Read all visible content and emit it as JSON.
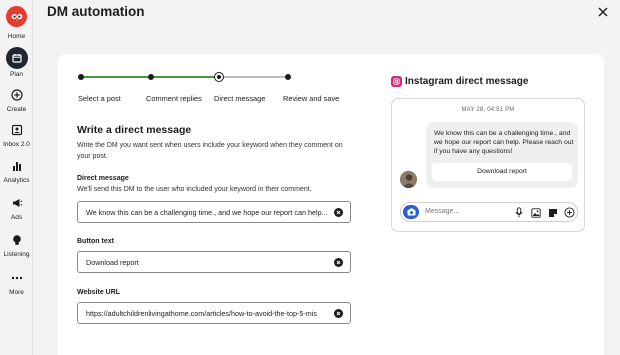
{
  "header": {
    "title": "DM automation"
  },
  "sidebar": {
    "items": [
      {
        "label": "Home",
        "icon": "home-icon"
      },
      {
        "label": "Plan",
        "icon": "calendar-icon"
      },
      {
        "label": "Create",
        "icon": "plus-icon"
      },
      {
        "label": "Inbox 2.0",
        "icon": "inbox-icon"
      },
      {
        "label": "Analytics",
        "icon": "chart-icon"
      },
      {
        "label": "Ads",
        "icon": "megaphone-icon"
      },
      {
        "label": "Listening",
        "icon": "lightbulb-icon"
      },
      {
        "label": "More",
        "icon": "ellipsis-icon"
      }
    ]
  },
  "steps": [
    {
      "label": "Select a post",
      "state": "done"
    },
    {
      "label": "Comment replies",
      "state": "done"
    },
    {
      "label": "Direct message",
      "state": "current"
    },
    {
      "label": "Review and save",
      "state": "upcoming"
    }
  ],
  "form": {
    "heading": "Write a direct message",
    "description": "Write the DM you want sent when users include your keyword when they comment on your post.",
    "dm_label": "Direct message",
    "dm_hint": "We'll send this DM to the user who included your keyword in their comment.",
    "dm_value": "We know this can be a challenging time., and we hope our report can help...",
    "button_label": "Button text",
    "button_value": "Download report",
    "url_label": "Website URL",
    "url_value": "https://adultchildrenlivingathome.com/articles/how-to-avoid-the-top-5-mis"
  },
  "preview": {
    "title": "Instagram direct message",
    "timestamp": "MAY 28, 04:51 PM",
    "message": "We know this can be a challenging time., and we hope our report can help. Please reach out if you have any questions!",
    "button": "Download report",
    "composer_placeholder": "Message..."
  },
  "colors": {
    "accent_green": "#3f9a3a",
    "brand_red": "#e53b30",
    "instagram": "#d62976",
    "camera_blue": "#2a5fd6"
  }
}
